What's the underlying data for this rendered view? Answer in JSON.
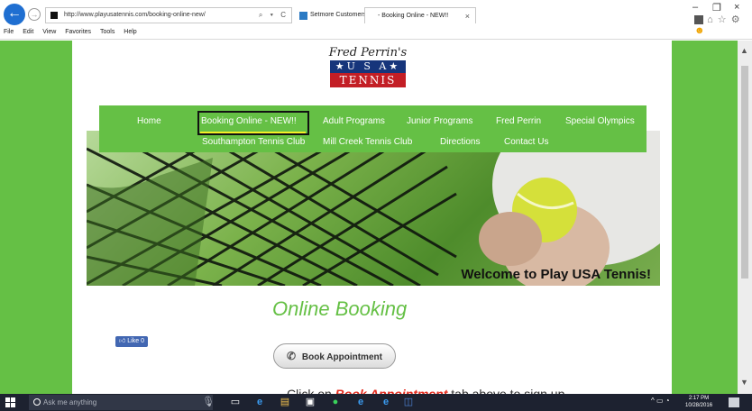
{
  "browser": {
    "url": "http://www.playusatennis.com/booking-online-new/",
    "address_controls": "⌕ ▾ C",
    "tabs": [
      {
        "label": "Setmore Customers"
      },
      {
        "label": "- Booking Online - NEW!!"
      }
    ],
    "tab_close": "×",
    "window_controls": {
      "minimize": "–",
      "restore": "❐",
      "close": "×"
    },
    "menu": [
      "File",
      "Edit",
      "View",
      "Favorites",
      "Tools",
      "Help"
    ]
  },
  "site": {
    "logo": {
      "script": "Fred Perrin's",
      "usa": "★U S A★",
      "tennis": "TENNIS"
    },
    "nav": {
      "row1": [
        "Home",
        "Booking Online - NEW!!",
        "Adult Programs",
        "Junior Programs",
        "Fred Perrin",
        "Special Olympics"
      ],
      "row2": [
        "Southampton Tennis Club",
        "Mill Creek Tennis Club",
        "Directions",
        "Contact Us"
      ]
    },
    "banner": {
      "welcome": "Welcome to Play USA Tennis!"
    },
    "like": {
      "label": "Like 0"
    },
    "heading": "Online Booking",
    "book_button": "Book Appointment",
    "cutoff": {
      "prefix": "Click on ",
      "highlight": "Book Appointment",
      "suffix": " tab above to sign up"
    }
  },
  "taskbar": {
    "search_placeholder": "Ask me anything",
    "clock": {
      "time": "2:17 PM",
      "date": "10/28/2016"
    }
  }
}
